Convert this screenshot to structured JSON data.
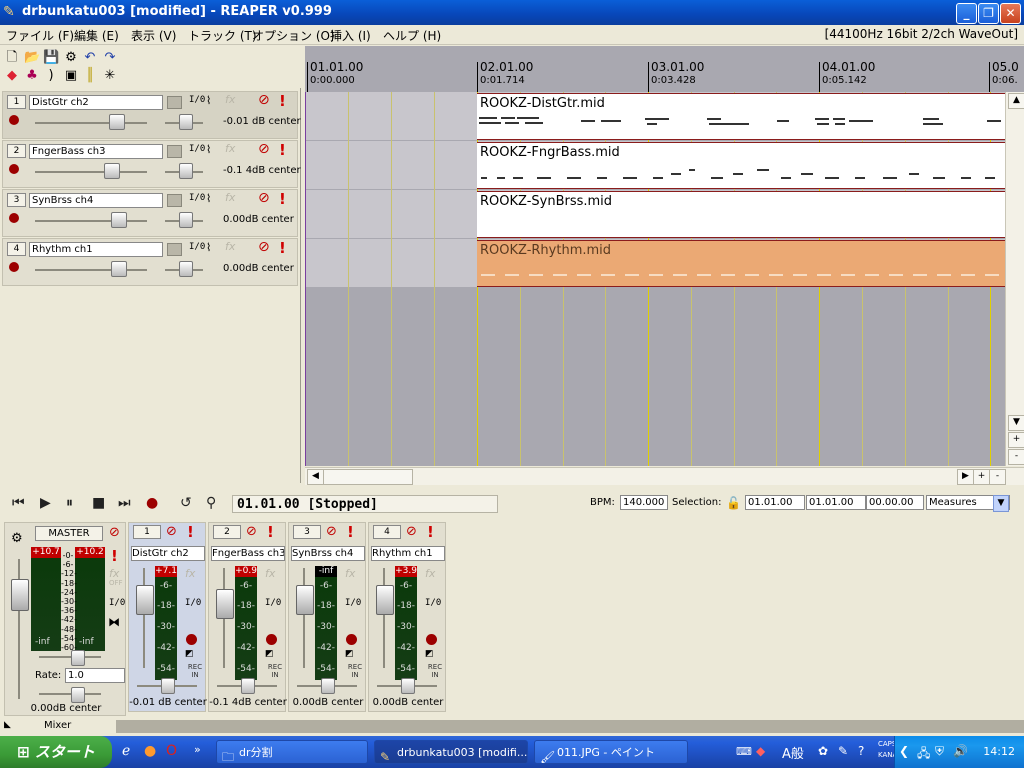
{
  "window": {
    "title": "drbunkatu003 [modified] - REAPER v0.999"
  },
  "menu": {
    "items": [
      "ファイル (F)",
      "編集 (E)",
      "表示 (V)",
      "トラック (T)",
      "オプション (O)",
      "挿入 (I)",
      "ヘルプ (H)"
    ],
    "audio_info": "[44100Hz 16bit 2/2ch WaveOut]"
  },
  "tracks": [
    {
      "num": "1",
      "name": "DistGtr ch2",
      "vol": "-0.01 dB center",
      "io": "I/0"
    },
    {
      "num": "2",
      "name": "FngerBass ch3",
      "vol": "-0.1 4dB center",
      "io": "I/0"
    },
    {
      "num": "3",
      "name": "SynBrss ch4",
      "vol": "0.00dB center",
      "io": "I/0"
    },
    {
      "num": "4",
      "name": "Rhythm ch1",
      "vol": "0.00dB center",
      "io": "I/0"
    }
  ],
  "ruler": {
    "marks": [
      {
        "bar": "01.01.00",
        "time": "0:00.000"
      },
      {
        "bar": "02.01.00",
        "time": "0:01.714"
      },
      {
        "bar": "03.01.00",
        "time": "0:03.428"
      },
      {
        "bar": "04.01.00",
        "time": "0:05.142"
      },
      {
        "bar": "05.0",
        "time": "0:06."
      }
    ]
  },
  "items": [
    {
      "name": "ROOKZ-DistGtr.mid",
      "color": "#ffffff"
    },
    {
      "name": "ROOKZ-FngrBass.mid",
      "color": "#ffffff"
    },
    {
      "name": "ROOKZ-SynBrss.mid",
      "color": "#ffffff"
    },
    {
      "name": "ROOKZ-Rhythm.mid",
      "color": "#eba974"
    }
  ],
  "transport": {
    "status": "01.01.00 [Stopped]",
    "bpm_label": "BPM:",
    "bpm": "140.000",
    "selection_label": "Selection:",
    "sel_start": "01.01.00",
    "sel_end": "01.01.00",
    "sel_len": "00.00.00",
    "units": "Measures"
  },
  "mixer": {
    "label": "Mixer",
    "master": {
      "name": "MASTER",
      "peak_l": "+10.7",
      "peak_r": "+10.2",
      "inf_l": "-inf",
      "inf_r": "-inf",
      "scale": [
        "-0-",
        "-6-",
        "-12-",
        "-18-",
        "-24-",
        "-30-",
        "-36-",
        "-42-",
        "-48-",
        "-54-",
        "-60-"
      ],
      "rate_label": "Rate:",
      "rate": "1.0",
      "vol": "0.00dB center",
      "io": "I/0"
    },
    "strips": [
      {
        "num": "1",
        "name": "DistGtr ch2",
        "peak": "+7.1",
        "vol": "-0.01 dB center"
      },
      {
        "num": "2",
        "name": "FngerBass ch3",
        "peak": "+0.9",
        "vol": "-0.1 4dB center"
      },
      {
        "num": "3",
        "name": "SynBrss ch4",
        "peak": "-inf",
        "vol": "0.00dB center"
      },
      {
        "num": "4",
        "name": "Rhythm ch1",
        "peak": "+3.9",
        "vol": "0.00dB center"
      }
    ],
    "strip_scale": [
      "-6-",
      "-18-",
      "-30-",
      "-42-",
      "-54-"
    ],
    "fx_label": "fx",
    "off_label": "OFF",
    "rec_in": "REC IN"
  },
  "taskbar": {
    "start": "スタート",
    "items": [
      {
        "label": "dr分割"
      },
      {
        "label": "drbunkatu003 [modifi..."
      },
      {
        "label": "011.JPG - ペイント"
      }
    ],
    "ime": "A般",
    "caps": "CAPS",
    "kana": "KANA",
    "clock": "14:12"
  },
  "colors": {
    "title_bar": "#0846b8",
    "item_border": "#8a1c1c",
    "rhythm_item": "#eba974",
    "grid_measure": "#e0d000",
    "arrange_bg": "#a9a8b0"
  }
}
